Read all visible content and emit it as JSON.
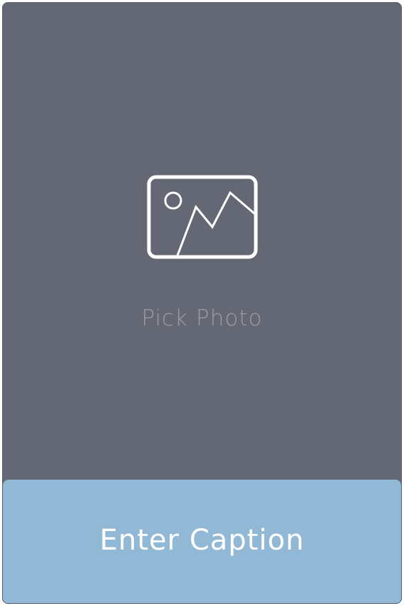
{
  "photo_picker": {
    "icon": "image-icon",
    "label": "Pick Photo"
  },
  "caption": {
    "label": "Enter Caption"
  },
  "colors": {
    "card_background": "#646874",
    "button_background": "#91b8d4",
    "label_muted": "#9a9ca6",
    "text_on_button": "#ffffff"
  }
}
